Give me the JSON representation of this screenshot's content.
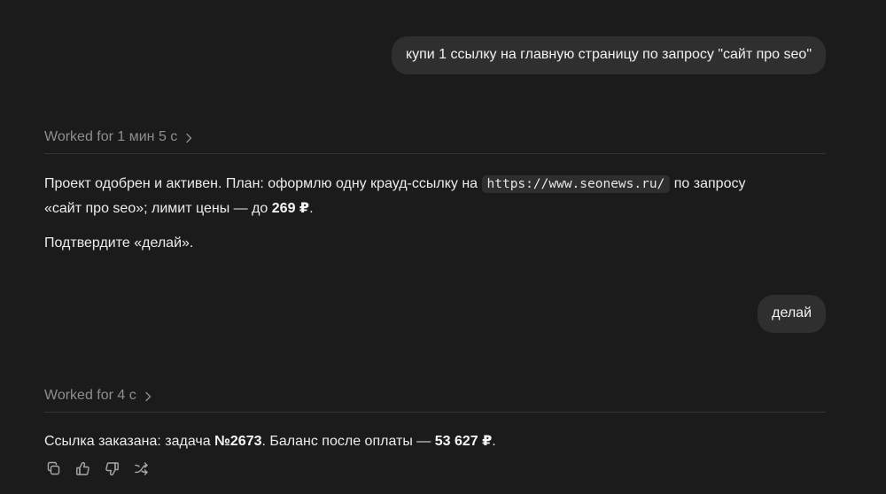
{
  "conversation": {
    "messages": [
      {
        "role": "user",
        "text": "купи 1 ссылку на главную страницу по запросу \"сайт про seo\""
      },
      {
        "role": "assistant",
        "worked_label": "Worked for 1 мин 5 с",
        "line1_prefix": "Проект одобрен и активен. План: оформлю одну крауд-ссылку на",
        "url": "https://www.seonews.ru/",
        "line1_suffix": "по запросу",
        "line2_prefix": "«сайт про seo»; лимит цены — до",
        "price_limit": "269 ₽",
        "line2_suffix": ".",
        "confirm": "Подтвердите «делай»."
      },
      {
        "role": "user",
        "text": "делай"
      },
      {
        "role": "assistant",
        "worked_label": "Worked for 4 с",
        "text_prefix": "Ссылка заказана: задача",
        "task_id": "№2673",
        "text_middle": ". Баланс после оплаты —",
        "balance": "53 627 ₽",
        "text_suffix": "."
      }
    ]
  },
  "actions": {
    "icons": [
      "copy-icon",
      "thumbs-up-icon",
      "thumbs-down-icon",
      "share-icon"
    ]
  },
  "colors": {
    "background": "#1b1b1b",
    "user_bubble": "#2f2f2f",
    "muted_text": "#8e8e8e",
    "main_text": "#ececec"
  }
}
